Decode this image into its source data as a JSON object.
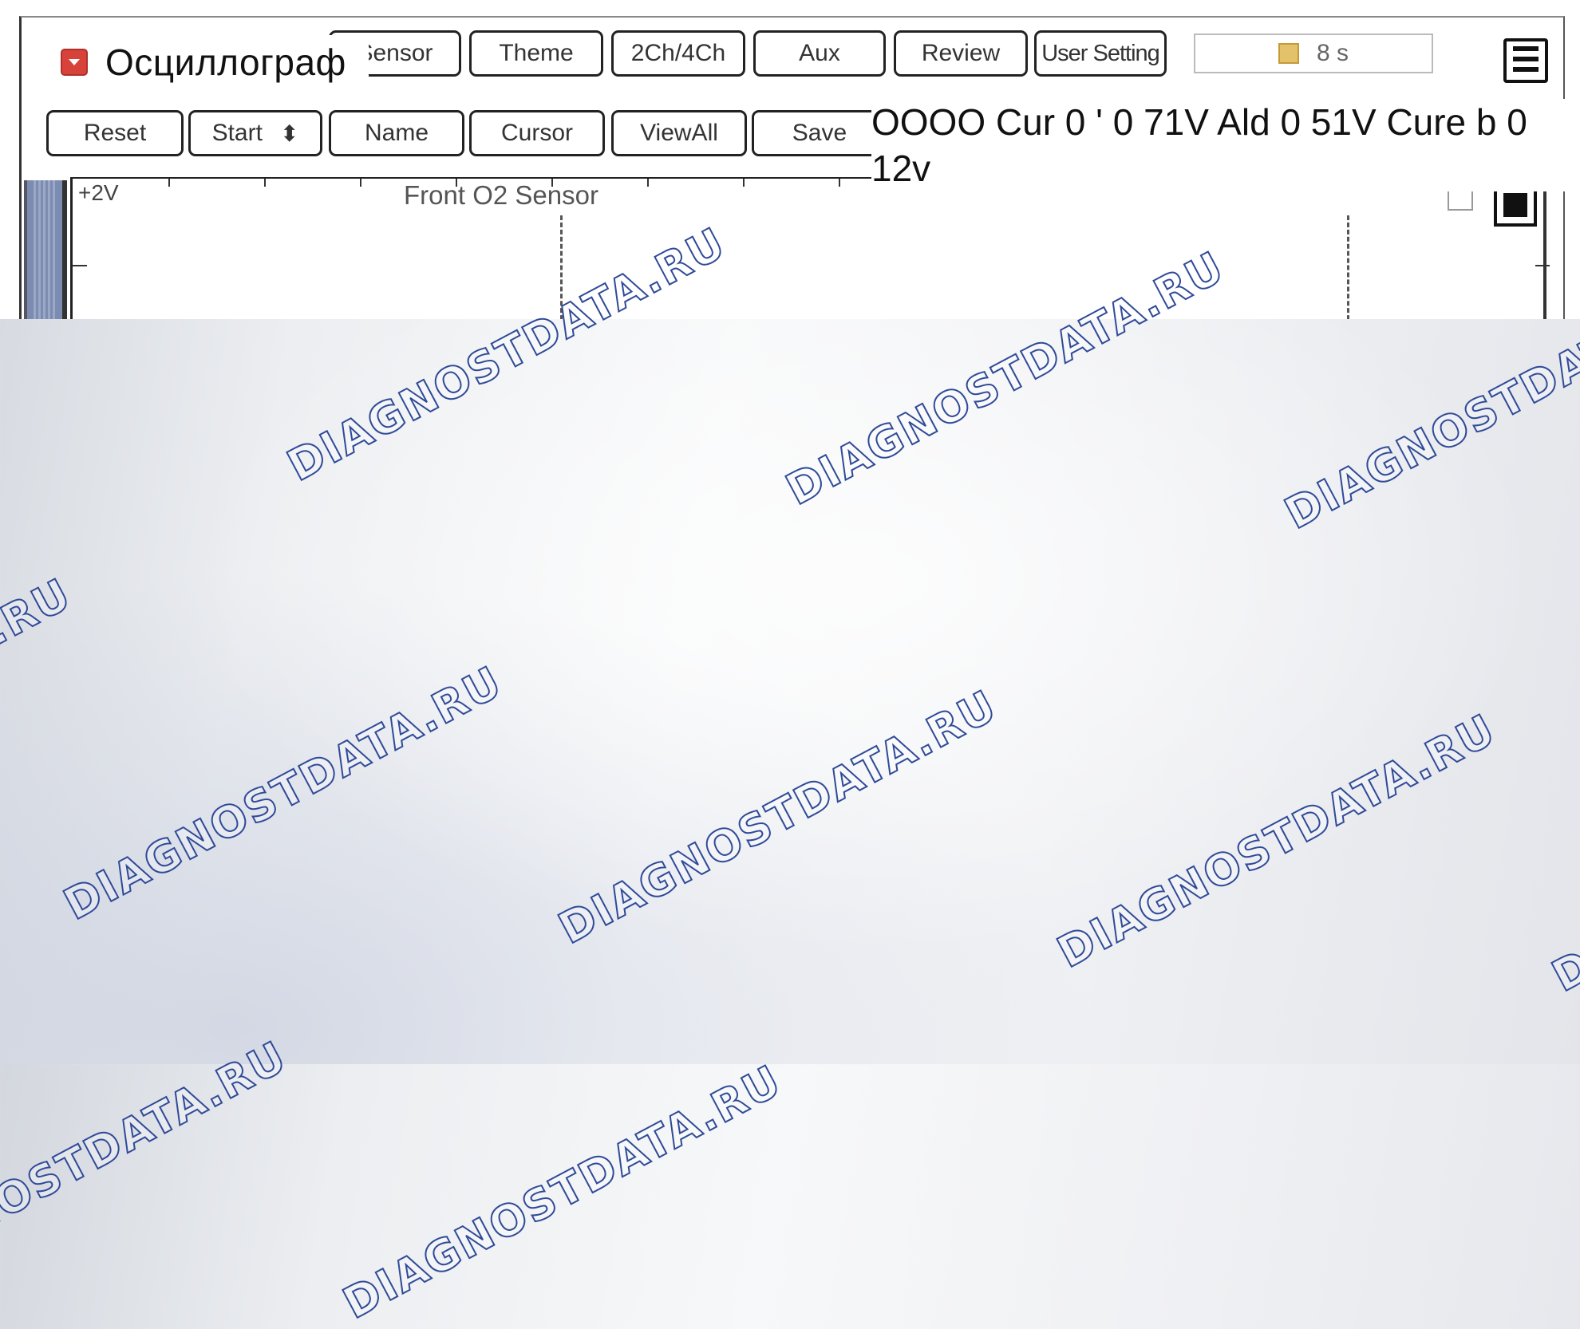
{
  "window": {
    "title": "Осциллограф"
  },
  "toolbar_row1": [
    {
      "label": "Sensor",
      "name": "sensor-button"
    },
    {
      "label": "Theme",
      "name": "theme-button"
    },
    {
      "label": "2Ch/4Ch",
      "name": "channels-button"
    },
    {
      "label": "Aux",
      "name": "aux-button"
    },
    {
      "label": "Review",
      "name": "review-button"
    },
    {
      "label": "User Setting",
      "name": "user-setting-button"
    }
  ],
  "toolbar_row2": [
    {
      "label": "Reset",
      "name": "reset-button"
    },
    {
      "label": "Start",
      "name": "start-button",
      "spinner": "⬍"
    },
    {
      "label": "Name",
      "name": "name-button"
    },
    {
      "label": "Cursor",
      "name": "cursor-button"
    },
    {
      "label": "ViewAll",
      "name": "viewall-button"
    },
    {
      "label": "Save",
      "name": "save-button"
    }
  ],
  "timer": {
    "value": "8 s",
    "icon": "hourglass-icon"
  },
  "readout": "OOOO Cur 0 ' 0 71V Ald 0 51V Cure b 0 12v",
  "plot": {
    "y_label": "+2V",
    "title": "Front O2 Sensor"
  },
  "watermark": "DIAGNOSTDATA.RU",
  "colors": {
    "icon_red": "#d7433b",
    "handle": "#7c8bb0",
    "watermark_outline": "#2f4a98"
  }
}
